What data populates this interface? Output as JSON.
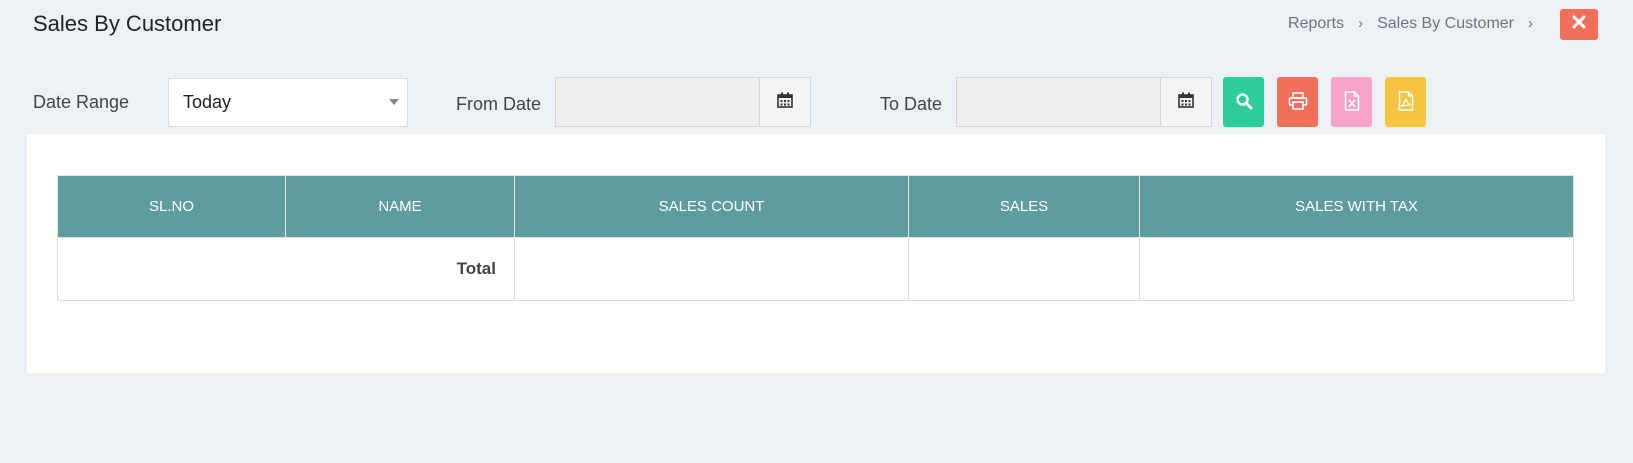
{
  "header": {
    "title": "Sales By Customer",
    "breadcrumb": [
      "Reports",
      "Sales By Customer"
    ],
    "breadcrumb_separator": "›",
    "close_icon": "close-icon"
  },
  "filters": {
    "date_range_label": "Date Range",
    "date_range_value": "Today",
    "from_date_label": "From Date",
    "from_date_value": "",
    "to_date_label": "To Date",
    "to_date_value": ""
  },
  "actions": [
    {
      "name": "search-button",
      "icon": "search-icon",
      "color": "#2ecc9a"
    },
    {
      "name": "print-button",
      "icon": "printer-icon",
      "color": "#f0705a"
    },
    {
      "name": "excel-button",
      "icon": "excel-file-icon",
      "color": "#f4a4c8"
    },
    {
      "name": "pdf-button",
      "icon": "pdf-file-icon",
      "color": "#f5c542"
    }
  ],
  "table": {
    "columns": [
      "SL.NO",
      "NAME",
      "SALES COUNT",
      "SALES",
      "SALES WITH TAX"
    ],
    "total_label": "Total",
    "totals": {
      "sales_count": "",
      "sales": "",
      "sales_with_tax": ""
    }
  },
  "colors": {
    "background": "#edf0f5",
    "table_header": "#5f9c9f",
    "close_button": "#f0705a"
  }
}
